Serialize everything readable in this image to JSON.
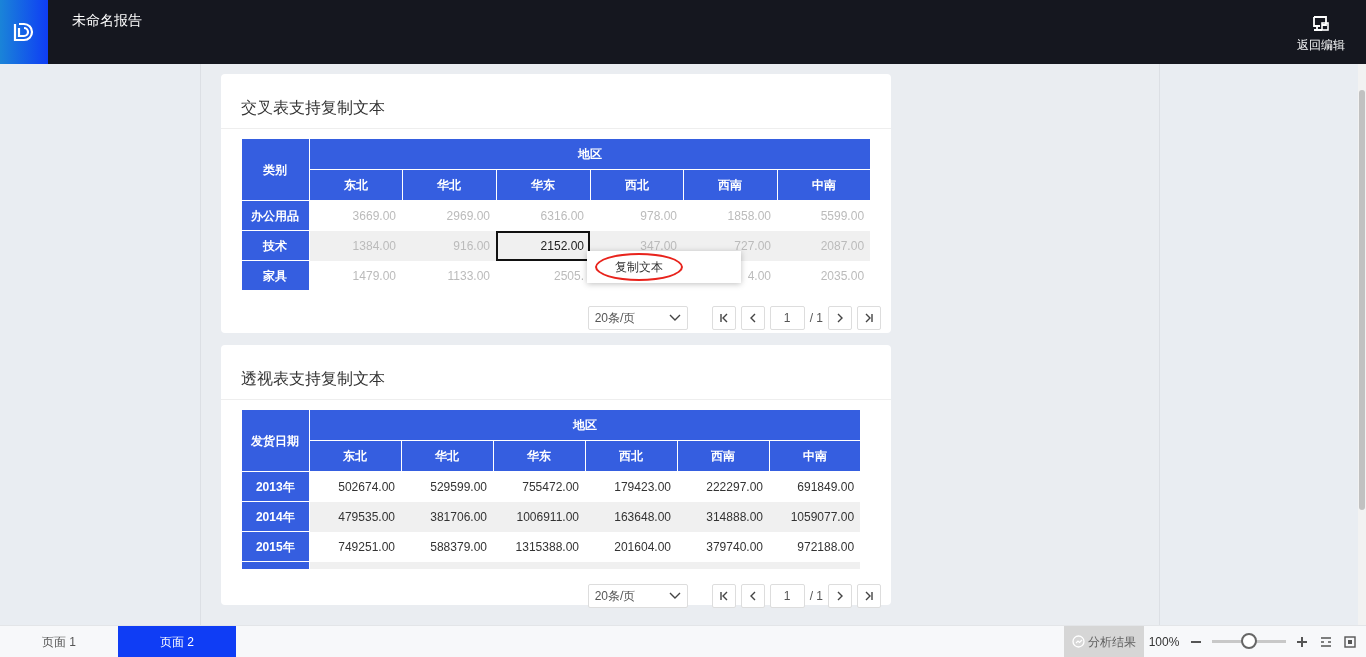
{
  "header": {
    "title": "未命名报告",
    "action": "返回编辑"
  },
  "tables": [
    {
      "kind": "cross",
      "title": "交叉表支持复制文本",
      "corner": "类别",
      "group": "地区",
      "columns": [
        "东北",
        "华北",
        "华东",
        "西北",
        "西南",
        "中南"
      ],
      "rows": [
        {
          "label": "办公用品",
          "cells": [
            {
              "text": "3669.00",
              "selected": false
            },
            {
              "text": "2969.00",
              "selected": false
            },
            {
              "text": "6316.00",
              "selected": false
            },
            {
              "text": "978.00",
              "selected": false
            },
            {
              "text": "1858.00",
              "selected": false
            },
            {
              "text": "5599.00",
              "selected": false
            }
          ]
        },
        {
          "label": "技术",
          "cells": [
            {
              "text": "1384.00",
              "selected": false
            },
            {
              "text": "916.00",
              "selected": false
            },
            {
              "text": "2152.00",
              "selected": true
            },
            {
              "text": "347.00",
              "selected": false
            },
            {
              "text": "727.00",
              "selected": false
            },
            {
              "text": "2087.00",
              "selected": false
            }
          ]
        },
        {
          "label": "家具",
          "cells": [
            {
              "text": "1479.00",
              "selected": false
            },
            {
              "text": "1133.00",
              "selected": false
            },
            {
              "text": "2505.",
              "selected": false
            },
            {
              "text": null,
              "selected": false
            },
            {
              "text": "4.00",
              "selected": false
            },
            {
              "text": "2035.00",
              "selected": false
            }
          ]
        }
      ],
      "context_menu": {
        "items": [
          {
            "label": "复制文本",
            "highlighted": true
          }
        ]
      },
      "pager": {
        "page_size": "20条/页",
        "page": "1",
        "total": "/ 1"
      }
    },
    {
      "kind": "pivot",
      "title": "透视表支持复制文本",
      "corner": "发货日期",
      "group": "地区",
      "columns": [
        "东北",
        "华北",
        "华东",
        "西北",
        "西南",
        "中南"
      ],
      "rows": [
        {
          "label": "2013年",
          "cells": [
            {
              "text": "502674.00",
              "selected": false
            },
            {
              "text": "529599.00",
              "selected": false
            },
            {
              "text": "755472.00",
              "selected": false
            },
            {
              "text": "179423.00",
              "selected": false
            },
            {
              "text": "222297.00",
              "selected": false
            },
            {
              "text": "691849.00",
              "selected": false
            }
          ]
        },
        {
          "label": "2014年",
          "cells": [
            {
              "text": "479535.00",
              "selected": false
            },
            {
              "text": "381706.00",
              "selected": false
            },
            {
              "text": "1006911.00",
              "selected": false
            },
            {
              "text": "163648.00",
              "selected": false
            },
            {
              "text": "314888.00",
              "selected": false
            },
            {
              "text": "1059077.00",
              "selected": false
            }
          ]
        },
        {
          "label": "2015年",
          "cells": [
            {
              "text": "749251.00",
              "selected": false
            },
            {
              "text": "588379.00",
              "selected": false
            },
            {
              "text": "1315388.00",
              "selected": false
            },
            {
              "text": "201604.00",
              "selected": false
            },
            {
              "text": "379740.00",
              "selected": false
            },
            {
              "text": "972188.00",
              "selected": false
            }
          ]
        }
      ],
      "pager": {
        "page_size": "20条/页",
        "page": "1",
        "total": "/ 1"
      }
    }
  ],
  "footer": {
    "pages": [
      {
        "label": "页面 1",
        "selected": false
      },
      {
        "label": "页面 2",
        "selected": true
      }
    ],
    "analysis": {
      "label": "分析结果",
      "disabled": true
    },
    "zoom": "100%",
    "zoom_slider": {
      "level": 0.5
    }
  }
}
